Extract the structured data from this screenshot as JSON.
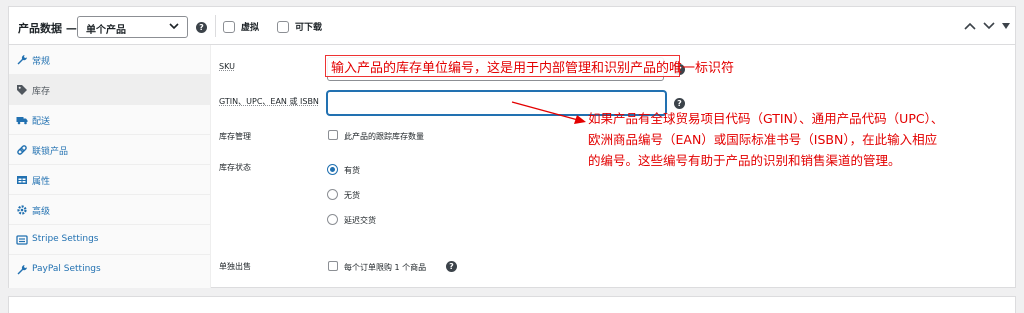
{
  "header": {
    "title": "产品数据 —",
    "product_type": "单个产品",
    "help": "?",
    "virtual_label": "虚拟",
    "downloadable_label": "可下载"
  },
  "sidebar": {
    "items": [
      {
        "label": "常规",
        "icon": "wrench-icon"
      },
      {
        "label": "库存",
        "icon": "tag-icon"
      },
      {
        "label": "配送",
        "icon": "truck-icon"
      },
      {
        "label": "联锁产品",
        "icon": "link-icon"
      },
      {
        "label": "属性",
        "icon": "table-icon"
      },
      {
        "label": "高级",
        "icon": "gear-icon"
      },
      {
        "label": "Stripe Settings",
        "icon": "settings-icon"
      },
      {
        "label": "PayPal Settings",
        "icon": "wrench-icon"
      }
    ],
    "active_index": 1
  },
  "inventory": {
    "sku_label": "SKU",
    "sku_value": "",
    "gtin_label": "GTIN、UPC、EAN 或 ISBN",
    "gtin_value": "",
    "manage_stock_label": "库存管理",
    "manage_stock_text": "此产品的跟踪库存数量",
    "stock_status_label": "库存状态",
    "stock_options": [
      "有货",
      "无货",
      "延迟交货"
    ],
    "stock_selected": "有货",
    "sold_individually_label": "单独出售",
    "sold_individually_text": "每个订单限购 1 个商品"
  },
  "annotations": {
    "sku_note": "输入产品的库存单位编号，这是用于内部管理和识别产品的唯一标识符",
    "gtin_note_lines": [
      "如果产品有全球贸易项目代码（GTIN）、通用产品代码（UPC）、",
      "欧洲商品编号（EAN）或国际标准书号（ISBN），在此输入相应",
      "的编号。这些编号有助于产品的识别和销售渠道的管理。"
    ],
    "color": "#e30000"
  },
  "colors": {
    "link": "#2271b1",
    "border": "#dcdcde",
    "background": "#f0f0f1"
  }
}
